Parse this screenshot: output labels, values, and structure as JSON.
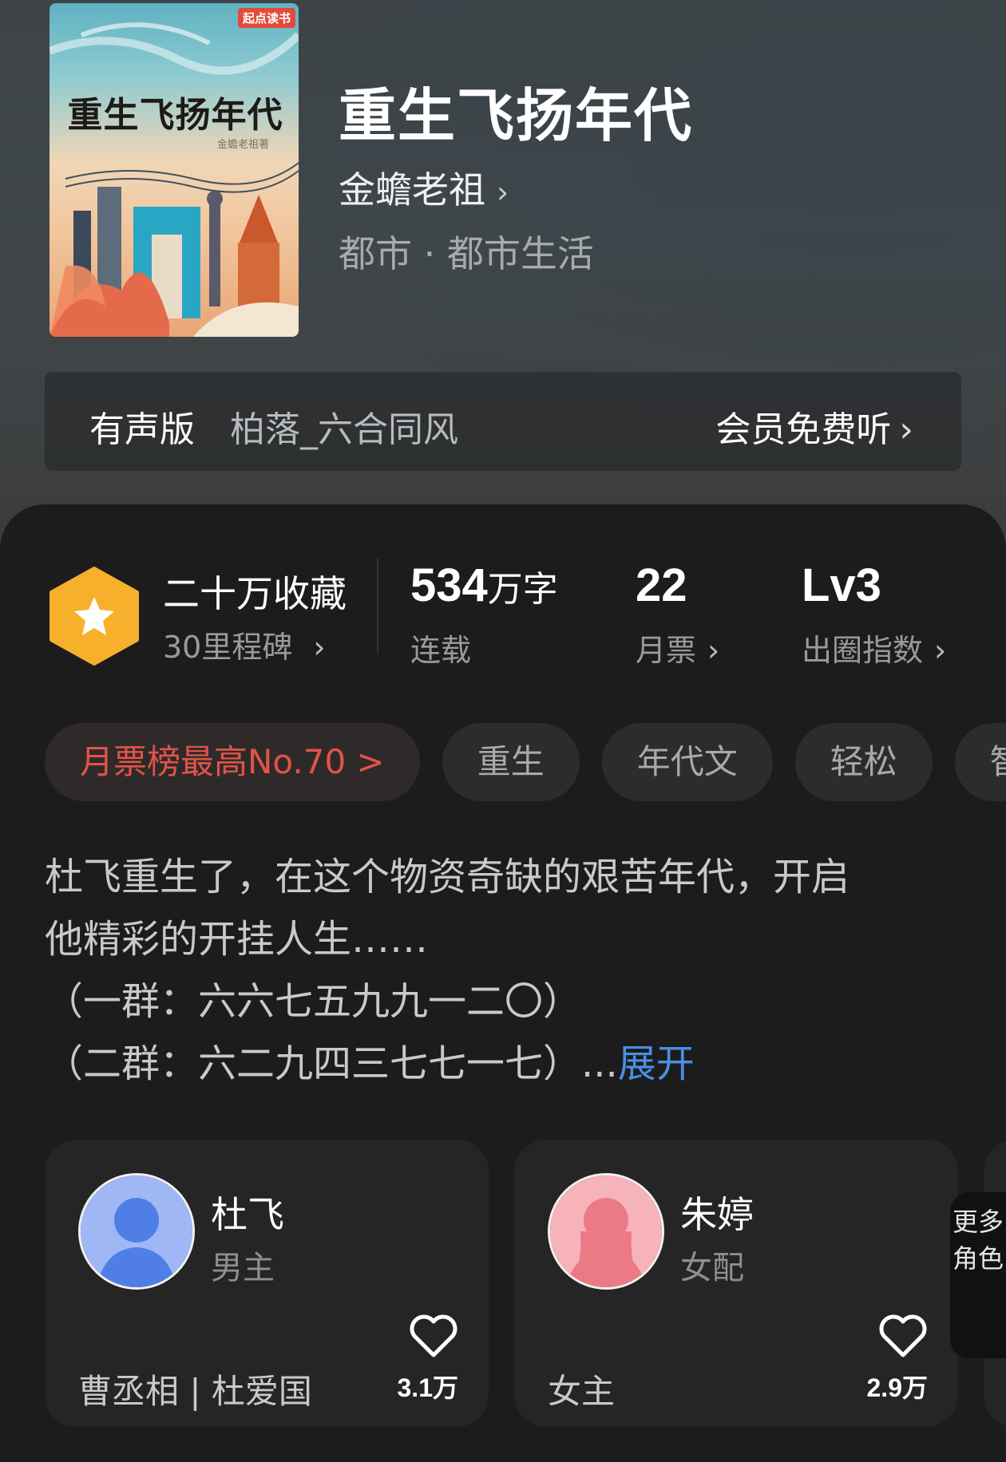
{
  "book": {
    "title": "重生飞扬年代",
    "cover_title": "重生飞扬年代",
    "cover_author": "金蟾老祖著",
    "cover_brand": "起点读书",
    "author": "金蟾老祖",
    "genre": "都市 · 都市生活"
  },
  "audio": {
    "label": "有声版",
    "narrator": "柏落_六合同风",
    "cta": "会员免费听"
  },
  "stats": {
    "collection_title": "二十万收藏",
    "collection_sub": "30里程碑",
    "words_value": "534",
    "words_unit": "万字",
    "words_label": "连载",
    "tickets_value": "22",
    "tickets_label": "月票",
    "index_value": "Lv3",
    "index_label": "出圈指数"
  },
  "tags": [
    "月票榜最高No.70 >",
    "重生",
    "年代文",
    "轻松",
    "智商在线"
  ],
  "synopsis": {
    "lines": [
      "杜飞重生了，在这个物资奇缺的艰苦年代，开启",
      "他精彩的开挂人生……",
      "（一群：六六七五九九一二〇）",
      "（二群：六二九四三七七一七）..."
    ],
    "expand": "展开"
  },
  "characters": [
    {
      "name": "杜飞",
      "role": "男主",
      "relation": "曹丞相 | 杜爱国",
      "likes": "3.1万",
      "color": "#4f7fe6"
    },
    {
      "name": "朱婷",
      "role": "女配",
      "relation": "女主",
      "likes": "2.9万",
      "color": "#ec7a86"
    }
  ],
  "more_roles": "更多角色",
  "icons": {
    "chevron": "chevron-right-icon",
    "heart": "heart-outline-icon",
    "hexagon": "star-hexagon-icon"
  },
  "colors": {
    "accent_red": "#e25348",
    "link_blue": "#4a8fe3",
    "badge_gold": "#f6b02c"
  }
}
